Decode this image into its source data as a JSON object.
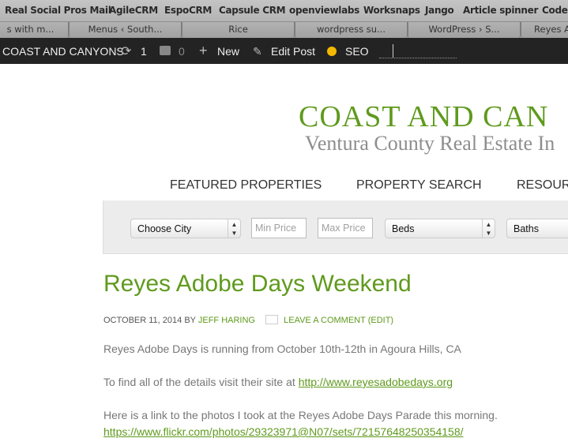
{
  "bookmarks": [
    "Real Social Pros Mail",
    "AgileCRM",
    "EspoCRM",
    "Capsule CRM",
    "openviewlabs",
    "Worksnaps",
    "Jango",
    "Article spinner",
    "CodeF"
  ],
  "tabs": [
    "s with m...",
    "Menus ‹ South...",
    "Rice",
    "wordpress su...",
    "WordPress › S...",
    "Reyes A"
  ],
  "admin": {
    "site": "COAST AND CANYONS",
    "updates": "1",
    "comments": "0",
    "new": "New",
    "edit": "Edit Post",
    "seo": "SEO",
    "seo_color": "#f5b800"
  },
  "header": {
    "title": "COAST AND CAN",
    "subtitle": "Ventura County Real Estate In"
  },
  "nav": [
    "FEATURED PROPERTIES",
    "PROPERTY SEARCH",
    "RESOUR"
  ],
  "search": {
    "city": "Choose City",
    "min_placeholder": "Min Price",
    "max_placeholder": "Max Price",
    "beds": "Beds",
    "baths": "Baths"
  },
  "post": {
    "title": "Reyes Adobe Days Weekend",
    "date": "OCTOBER 11, 2014",
    "by": "BY",
    "author": "JEFF HARING",
    "comment": "LEAVE A COMMENT",
    "edit": "(EDIT)",
    "p1": "Reyes Adobe Days is running from October 10th-12th in Agoura Hills, CA",
    "p2": "To find all of the details visit their site at",
    "link1": "http://www.reyesadobedays.org",
    "p3": "Here is a link to the photos I took at the Reyes Adobe Days Parade this morning.",
    "link2": "https://www.flickr.com/photos/29323971@N07/sets/72157648250354158/"
  },
  "colors": {
    "accent": "#5f9a1d",
    "adminbar": "#232323"
  }
}
